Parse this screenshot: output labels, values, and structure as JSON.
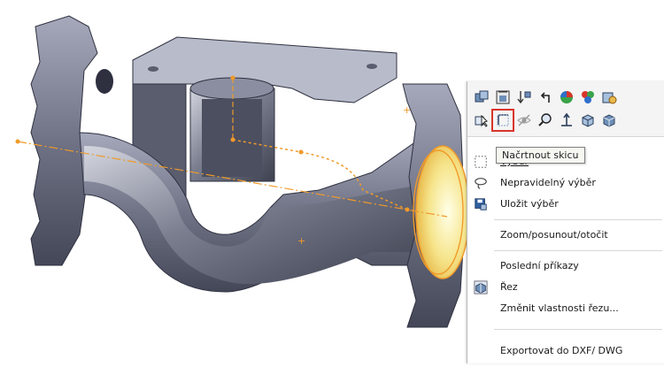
{
  "tooltip": "Načrtnout skicu",
  "menu": {
    "items": [
      {
        "key": "select",
        "label": "Výběr",
        "icon": "box-select-icon"
      },
      {
        "key": "lasso",
        "label": "Nepravidelný výběr",
        "icon": "lasso-icon"
      },
      {
        "key": "save",
        "label": "Uložit výběr",
        "icon": "save-selection-icon"
      },
      {
        "key": "zoom",
        "label": "Zoom/posunout/otočit",
        "icon": ""
      },
      {
        "key": "recent",
        "label": "Poslední příkazy",
        "icon": ""
      },
      {
        "key": "section",
        "label": "Řez",
        "icon": "section-view-icon"
      },
      {
        "key": "section-props",
        "label": "Změnit vlastnosti řezu...",
        "icon": ""
      },
      {
        "key": "export",
        "label": "Exportovat  do DXF/ DWG",
        "icon": ""
      }
    ]
  },
  "toolbar": {
    "row1": [
      "assembly-icon",
      "edit-part-icon",
      "insert-components-icon",
      "undo-icon",
      "appearance-icon",
      "scene-icon",
      "display-icon"
    ],
    "row2": [
      "select-tool-icon",
      "sketch-icon",
      "hide-icon",
      "zoom-icon",
      "normal-to-icon",
      "view-orientation-icon",
      "display-style-icon"
    ]
  },
  "colors": {
    "accent": "#f09a2a",
    "highlight": "#d9342b",
    "metal_dark": "#4a4d5e",
    "metal_light": "#9a9db0"
  }
}
